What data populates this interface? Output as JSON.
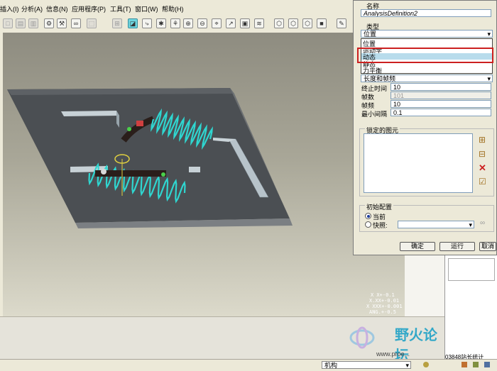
{
  "menu": {
    "items": [
      "插入(I)",
      "分析(A)",
      "信息(N)",
      "应用程序(P)",
      "工具(T)",
      "窗口(W)",
      "帮助(H)"
    ]
  },
  "toolbar": {
    "icons": [
      "new-icon",
      "open-icon",
      "save-icon",
      "print-icon",
      "spring-icon",
      "damper-icon",
      "binoculars-icon",
      "box-select-icon",
      "refit-icon",
      "sketch-icon",
      "motor-icon",
      "gear-icon",
      "zoom-in-icon",
      "zoom-out-icon",
      "analysis-icon",
      "measure-icon",
      "layers-icon",
      "view-icon",
      "shade-icon",
      "hidden-icon",
      "wireframe-icon",
      "edit-icon"
    ]
  },
  "viewport": {
    "coord_readout": [
      "X X+-0.1",
      "X.XX+-0.01",
      "X XXX+-0.001",
      "ANG.+-0.5"
    ]
  },
  "status": {
    "mode_select": "机构"
  },
  "watermark": {
    "text": "野火论坛",
    "url": "www.proe...",
    "post_count": "03848站长统计"
  },
  "dialog": {
    "name_label": "名称",
    "name_value": "AnalysisDefinition2",
    "type_label": "类型",
    "type_selected": "位置",
    "type_options": [
      "位置",
      "运动学",
      "动态",
      "静态",
      "力平衡"
    ],
    "highlighted_option": "动态",
    "preferences_select": "长度和帧频",
    "rows": [
      {
        "label": "终止时间",
        "value": "10",
        "disabled": false
      },
      {
        "label": "帧数",
        "value": "101",
        "disabled": true
      },
      {
        "label": "帧频",
        "value": "10",
        "disabled": false
      },
      {
        "label": "最小间隔",
        "value": "0.1",
        "disabled": false
      }
    ],
    "locked_label": "锁定的图元",
    "initial_label": "初始配置",
    "initial_current": "当前",
    "initial_snapshot": "快照:",
    "ok_label": "确定",
    "run_label": "运行",
    "cancel_label": "取消"
  }
}
